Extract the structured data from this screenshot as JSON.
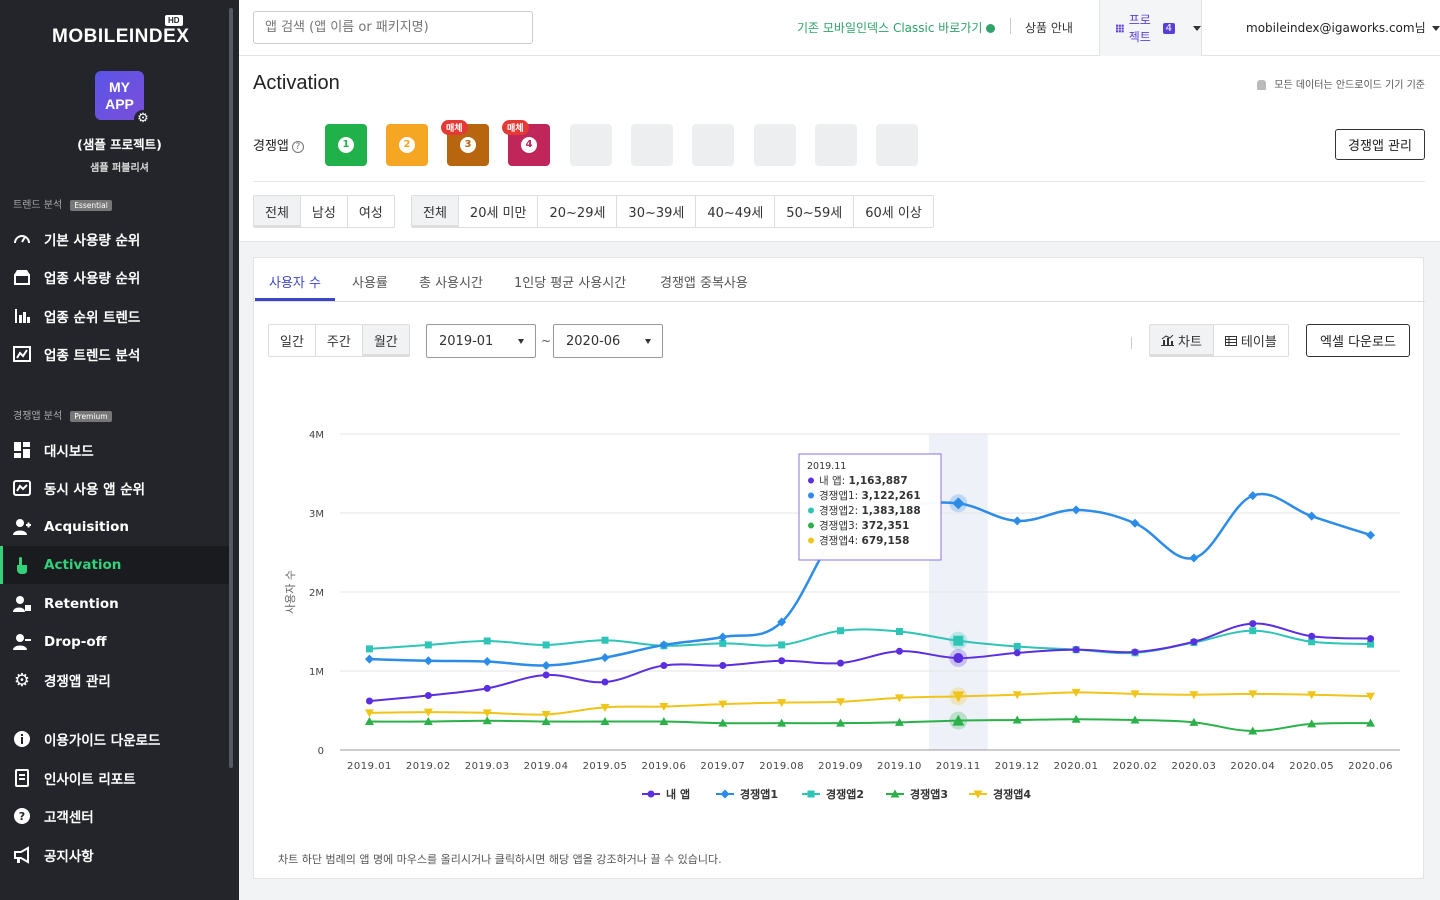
{
  "sidebar": {
    "logo": "MOBILEINDEX",
    "logo_badge": "HD",
    "myapp_label": "MY APP",
    "project_name": "(샘플 프로젝트)",
    "project_owner": "샘플 퍼블리셔",
    "section_trend": "트렌드 분석",
    "section_trend_badge": "Essential",
    "section_comp": "경쟁앱 분석",
    "section_comp_badge": "Premium",
    "items": [
      {
        "label": "기본 사용량 순위",
        "icon": "gauge-icon"
      },
      {
        "label": "업종 사용량 순위",
        "icon": "store-icon"
      },
      {
        "label": "업종 순위 트렌드",
        "icon": "bar-chart-icon"
      },
      {
        "label": "업종 트렌드 분석",
        "icon": "chart-image-icon"
      },
      {
        "label": "대시보드",
        "icon": "dashboard-icon"
      },
      {
        "label": "동시 사용 앱 순위",
        "icon": "overlap-chart-icon"
      },
      {
        "label": "Acquisition",
        "icon": "user-plus-icon"
      },
      {
        "label": "Activation",
        "icon": "hand-pointer-icon"
      },
      {
        "label": "Retention",
        "icon": "user-lock-icon"
      },
      {
        "label": "Drop-off",
        "icon": "user-minus-icon"
      },
      {
        "label": "경쟁앱 관리",
        "icon": "gear-icon"
      },
      {
        "label": "이용가이드 다운로드",
        "icon": "info-icon"
      },
      {
        "label": "인사이트 리포트",
        "icon": "report-icon"
      },
      {
        "label": "고객센터",
        "icon": "question-icon"
      },
      {
        "label": "공지사항",
        "icon": "megaphone-icon"
      }
    ]
  },
  "header": {
    "search_placeholder": "앱 검색 (앱 이름 or 패키지명)",
    "classic_link": "기존 모바일인덱스 Classic 바로가기",
    "product_info": "상품 안내",
    "project_label": "프로젝트",
    "project_count": "4",
    "user_email": "mobileindex@igaworks.com님"
  },
  "page": {
    "title": "Activation",
    "android_note": "모든 데이터는 안드로이드 기기 기준",
    "comp_label": "경쟁앱",
    "manage_button": "경쟁앱 관리",
    "apps": [
      {
        "num": "1",
        "color": "#20b14a"
      },
      {
        "num": "2",
        "color": "#f5a623"
      },
      {
        "num": "3",
        "color": "#b8650f",
        "badge": "매체"
      },
      {
        "num": "4",
        "color": "#c0265a",
        "badge": "매체"
      }
    ],
    "gender_filters": [
      "전체",
      "남성",
      "여성"
    ],
    "age_filters": [
      "전체",
      "20세 미만",
      "20~29세",
      "30~39세",
      "40~49세",
      "50~59세",
      "60세 이상"
    ]
  },
  "chart_panel": {
    "tabs": [
      "사용자 수",
      "사용률",
      "총 사용시간",
      "1인당 평균 사용시간",
      "경쟁앱 중복사용"
    ],
    "periods": [
      "일간",
      "주간",
      "월간"
    ],
    "date_from": "2019-01",
    "date_to": "2020-06",
    "tilde": "~",
    "view_chart": "차트",
    "view_table": "테이블",
    "excel_button": "엑셀 다운로드",
    "footnote": "차트 하단 범례의 앱 명에 마우스를 올리시거나 클릭하시면 해당 앱을 강조하거나 끌 수 있습니다."
  },
  "chart_data": {
    "type": "line",
    "ylabel": "사용자 수",
    "ylim": [
      0,
      4000000
    ],
    "yticks": [
      {
        "v": 0,
        "label": "0"
      },
      {
        "v": 1000000,
        "label": "1M"
      },
      {
        "v": 2000000,
        "label": "2M"
      },
      {
        "v": 3000000,
        "label": "3M"
      },
      {
        "v": 4000000,
        "label": "4M"
      }
    ],
    "categories": [
      "2019.01",
      "2019.02",
      "2019.03",
      "2019.04",
      "2019.05",
      "2019.06",
      "2019.07",
      "2019.08",
      "2019.09",
      "2019.10",
      "2019.11",
      "2019.12",
      "2020.01",
      "2020.02",
      "2020.03",
      "2020.04",
      "2020.05",
      "2020.06"
    ],
    "highlight_index": 10,
    "series": [
      {
        "name": "내 앱",
        "color": "#5b2ee0",
        "marker": "circle",
        "values": [
          620000,
          690000,
          780000,
          950000,
          860000,
          1070000,
          1070000,
          1130000,
          1100000,
          1250000,
          1163887,
          1230000,
          1270000,
          1240000,
          1370000,
          1600000,
          1440000,
          1410000
        ]
      },
      {
        "name": "경쟁앱1",
        "color": "#2d8ce8",
        "marker": "diamond",
        "values": [
          1150000,
          1130000,
          1120000,
          1070000,
          1170000,
          1330000,
          1430000,
          1620000,
          2800000,
          3060000,
          3122261,
          2900000,
          3040000,
          2870000,
          2430000,
          3220000,
          2960000,
          2720000
        ]
      },
      {
        "name": "경쟁앱2",
        "color": "#2ec4b6",
        "marker": "square",
        "values": [
          1280000,
          1330000,
          1380000,
          1330000,
          1390000,
          1320000,
          1350000,
          1330000,
          1510000,
          1500000,
          1383188,
          1310000,
          1270000,
          1230000,
          1360000,
          1510000,
          1370000,
          1340000
        ]
      },
      {
        "name": "경쟁앱3",
        "color": "#2bb04a",
        "marker": "triangle",
        "values": [
          360000,
          360000,
          370000,
          360000,
          360000,
          360000,
          340000,
          340000,
          340000,
          350000,
          372351,
          380000,
          390000,
          380000,
          350000,
          240000,
          330000,
          340000
        ]
      },
      {
        "name": "경쟁앱4",
        "color": "#f0c419",
        "marker": "triangle-down",
        "values": [
          470000,
          480000,
          470000,
          450000,
          540000,
          550000,
          580000,
          600000,
          610000,
          660000,
          679158,
          700000,
          730000,
          710000,
          700000,
          710000,
          700000,
          680000
        ]
      }
    ],
    "tooltip": {
      "title": "2019.11",
      "rows": [
        {
          "name": "내 앱",
          "value": "1,163,887",
          "color": "#5b2ee0"
        },
        {
          "name": "경쟁앱1",
          "value": "3,122,261",
          "color": "#2d8ce8"
        },
        {
          "name": "경쟁앱2",
          "value": "1,383,188",
          "color": "#2ec4b6"
        },
        {
          "name": "경쟁앱3",
          "value": "372,351",
          "color": "#2bb04a"
        },
        {
          "name": "경쟁앱4",
          "value": "679,158",
          "color": "#f0c419"
        }
      ]
    },
    "legend_position": "bottom"
  }
}
